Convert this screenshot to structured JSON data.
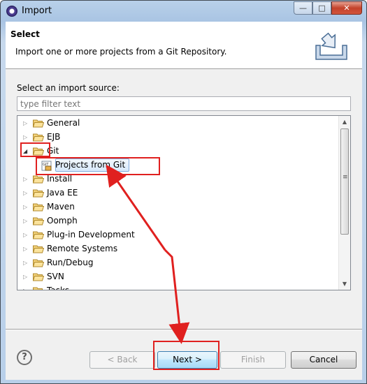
{
  "window": {
    "title": "Import",
    "minimize_glyph": "—",
    "maximize_glyph": "□",
    "close_glyph": "✕"
  },
  "header": {
    "title": "Select",
    "description": "Import one or more projects from a Git Repository.",
    "icon": "import-wizard-icon"
  },
  "source": {
    "label": "Select an import source:",
    "filter_placeholder": "type filter text"
  },
  "tree": {
    "items": [
      {
        "label": "General",
        "expanded": false
      },
      {
        "label": "EJB",
        "expanded": false
      },
      {
        "label": "Git",
        "expanded": true
      },
      {
        "label": "Projects from Git",
        "child": true,
        "selected": true
      },
      {
        "label": "Install",
        "expanded": false
      },
      {
        "label": "Java EE",
        "expanded": false
      },
      {
        "label": "Maven",
        "expanded": false
      },
      {
        "label": "Oomph",
        "expanded": false
      },
      {
        "label": "Plug-in Development",
        "expanded": false
      },
      {
        "label": "Remote Systems",
        "expanded": false
      },
      {
        "label": "Run/Debug",
        "expanded": false
      },
      {
        "label": "SVN",
        "expanded": false
      },
      {
        "label": "Tasks",
        "expanded": false
      }
    ]
  },
  "buttons": {
    "help": "?",
    "back": "< Back",
    "next": "Next >",
    "finish": "Finish",
    "cancel": "Cancel"
  },
  "colors": {
    "annotation": "#e0201f",
    "selection": "#d6e8fb"
  }
}
